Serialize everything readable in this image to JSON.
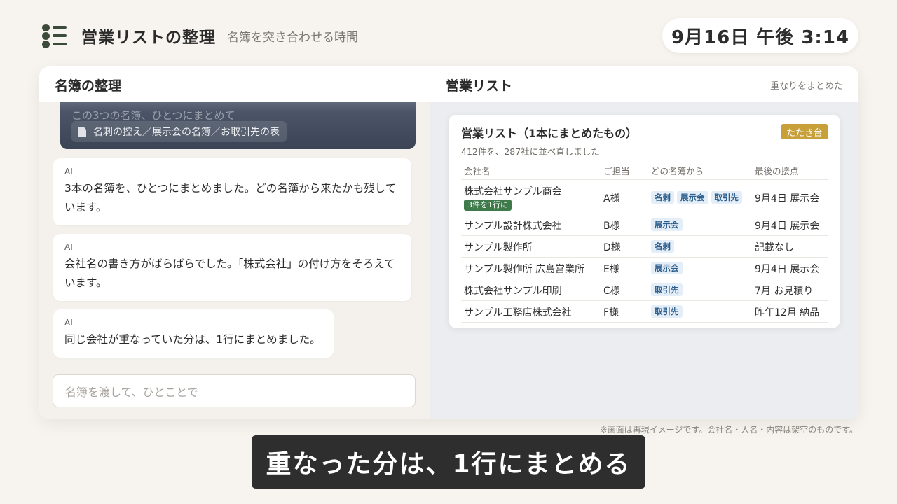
{
  "header": {
    "icon": "list-icon",
    "title": "営業リストの整理",
    "subtitle": "名簿を突き合わせる時間",
    "clock": "9月16日 午後 3:14"
  },
  "left_panel": {
    "title": "名簿の整理",
    "user_message": {
      "text": "この3つの名簿、ひとつにまとめて",
      "attachment_icon": "document-icon",
      "attachments": "名刺の控え／展示会の名簿／お取引先の表"
    },
    "messages": [
      {
        "sender": "AI",
        "text": "3本の名簿を、ひとつにまとめました。どの名簿から来たかも残しています。"
      },
      {
        "sender": "AI",
        "text": "会社名の書き方がばらばらでした。「株式会社」の付け方をそろえています。"
      },
      {
        "sender": "AI",
        "text": "同じ会社が重なっていた分は、1行にまとめました。"
      }
    ],
    "input_placeholder": "名簿を渡して、ひとことで"
  },
  "right_panel": {
    "title": "営業リスト",
    "note": "重なりをまとめた",
    "card": {
      "title": "営業リスト（1本にまとめたもの）",
      "badge": "たたき台",
      "summary": "412件を、287社に並べ直しました",
      "columns": [
        "会社名",
        "ご担当",
        "どの名簿から",
        "最後の接点"
      ],
      "rows": [
        {
          "company": "株式会社サンプル商会",
          "merge_note": "3件を1行に",
          "person": "A様",
          "sources": [
            "名刺",
            "展示会",
            "取引先"
          ],
          "last": "9月4日 展示会"
        },
        {
          "company": "サンプル設計株式会社",
          "person": "B様",
          "sources": [
            "展示会"
          ],
          "last": "9月4日 展示会"
        },
        {
          "company": "サンプル製作所",
          "person": "D様",
          "sources": [
            "名刺"
          ],
          "last": "記載なし"
        },
        {
          "company": "サンプル製作所 広島営業所",
          "person": "E様",
          "sources": [
            "展示会"
          ],
          "last": "9月4日 展示会"
        },
        {
          "company": "株式会社サンプル印刷",
          "person": "C様",
          "sources": [
            "取引先"
          ],
          "last": "7月 お見積り"
        },
        {
          "company": "サンプル工務店株式会社",
          "person": "F様",
          "sources": [
            "取引先"
          ],
          "last": "昨年12月 納品"
        }
      ]
    }
  },
  "disclaimer": "※画面は再現イメージです。会社名・人名・内容は架空のものです。",
  "caption": "重なった分は、1行にまとめる",
  "colors": {
    "background": "#f7f3ee",
    "badge_gold": "#c8a03a",
    "merge_green": "#3e7a4a",
    "tag_blue": "#2c5d8c",
    "caption_bg": "#2e2e2e"
  }
}
